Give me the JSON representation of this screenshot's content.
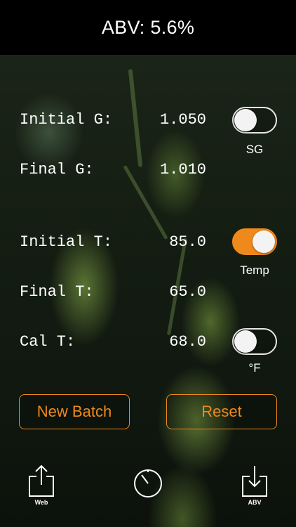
{
  "header": {
    "title": "ABV: 5.6%"
  },
  "rows": [
    {
      "label": "Initial G:",
      "value": "1.050"
    },
    {
      "label": "Final G:",
      "value": "1.010"
    },
    {
      "label": "Initial T:",
      "value": "85.0"
    },
    {
      "label": "Final T:",
      "value": "65.0"
    },
    {
      "label": "Cal T:",
      "value": "68.0"
    }
  ],
  "toggles": [
    {
      "label": "SG",
      "on": false
    },
    {
      "label": "Temp",
      "on": true
    },
    {
      "label": "°F",
      "on": false
    }
  ],
  "buttons": {
    "new_batch": "New Batch",
    "reset": "Reset"
  },
  "toolbar": {
    "web_label": "Web",
    "abv_label": "ABV"
  },
  "icons": {
    "share": "share-icon",
    "timer": "timer-icon",
    "download": "download-icon"
  },
  "colors": {
    "accent": "#f0891c",
    "text": "#ffffff",
    "header_bg": "#000000"
  }
}
